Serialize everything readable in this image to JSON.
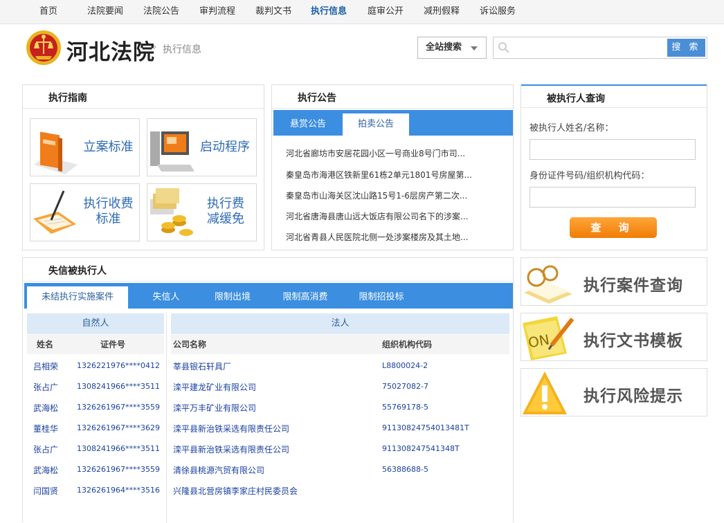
{
  "nav": {
    "items": [
      "首页",
      "法院要闻",
      "法院公告",
      "审判流程",
      "裁判文书",
      "执行信息",
      "庭审公开",
      "减刑假释",
      "诉讼服务"
    ],
    "active_index": 5
  },
  "header": {
    "site_title": "河北法院",
    "crumb_sep": "›",
    "crumb": "执行信息",
    "scope": "全站搜索",
    "search_placeholder": "",
    "search_button": "搜 索"
  },
  "guide": {
    "title": "执行指南",
    "cards": [
      {
        "label": "立案标准",
        "icon": "book-icon"
      },
      {
        "label": "启动程序",
        "icon": "computer-icon"
      },
      {
        "label": "执行收费\n标准",
        "icon": "writing-icon"
      },
      {
        "label": "执行费\n减缓免",
        "icon": "coins-icon"
      }
    ]
  },
  "announcements": {
    "title": "执行公告",
    "tabs": [
      "悬赏公告",
      "拍卖公告"
    ],
    "active_tab": 1,
    "items": [
      "河北省廊坊市安居花园小区一号商业8号门市司...",
      "秦皇岛市海港区铁新里61栋2单元1801号房屋第...",
      "秦皇岛市山海关区沈山路15号1-6层房产第二次...",
      "河北省唐海县唐山远大饭店有限公司名下的涉案...",
      "河北省青县人民医院北侧一处涉案楼房及其土地..."
    ]
  },
  "query": {
    "title": "被执行人查询",
    "name_label": "被执行人姓名/名称：",
    "id_label": "身份证件号码/组织机构代码：",
    "button": "查 询"
  },
  "dishonest": {
    "title": "失信被执行人",
    "tabs": [
      "未结执行实施案件",
      "失信人",
      "限制出境",
      "限制高消费",
      "限制招投标"
    ],
    "active_tab": 0,
    "natural": {
      "heading": "自然人",
      "col_name": "姓名",
      "col_id": "证件号",
      "rows": [
        {
          "name": "吕相荣",
          "id": "1326221976****0412"
        },
        {
          "name": "张占广",
          "id": "1308241966****3511"
        },
        {
          "name": "武海松",
          "id": "1326261967****3559"
        },
        {
          "name": "董桂华",
          "id": "1326261967****3629"
        },
        {
          "name": "张占广",
          "id": "1308241966****3511"
        },
        {
          "name": "武海松",
          "id": "1326261967****3559"
        },
        {
          "name": "闫国贤",
          "id": "1326261964****3516"
        }
      ]
    },
    "legal": {
      "heading": "法人",
      "col_company": "公司名称",
      "col_code": "组织机构代码",
      "rows": [
        {
          "company": "莘县银石轩具厂",
          "code": "L8800024-2"
        },
        {
          "company": "滦平建龙矿业有限公司",
          "code": "75027082-7"
        },
        {
          "company": "滦平万丰矿业有限公司",
          "code": "55769178-5"
        },
        {
          "company": "滦平县新治铁采选有限责任公司",
          "code": "91130824754013481T"
        },
        {
          "company": "滦平县新治铁采选有限责任公司",
          "code": "911308247541348T"
        },
        {
          "company": "清徐县桃源汽贸有限公司",
          "code": "56388688-5"
        },
        {
          "company": "兴隆县北营房镇李家庄村民委员会",
          "code": ""
        }
      ]
    }
  },
  "quick_links": [
    {
      "label": "执行案件查询",
      "icon": "magnifier-book-icon"
    },
    {
      "label": "执行文书模板",
      "icon": "document-pen-icon"
    },
    {
      "label": "执行风险提示",
      "icon": "warning-icon"
    }
  ]
}
